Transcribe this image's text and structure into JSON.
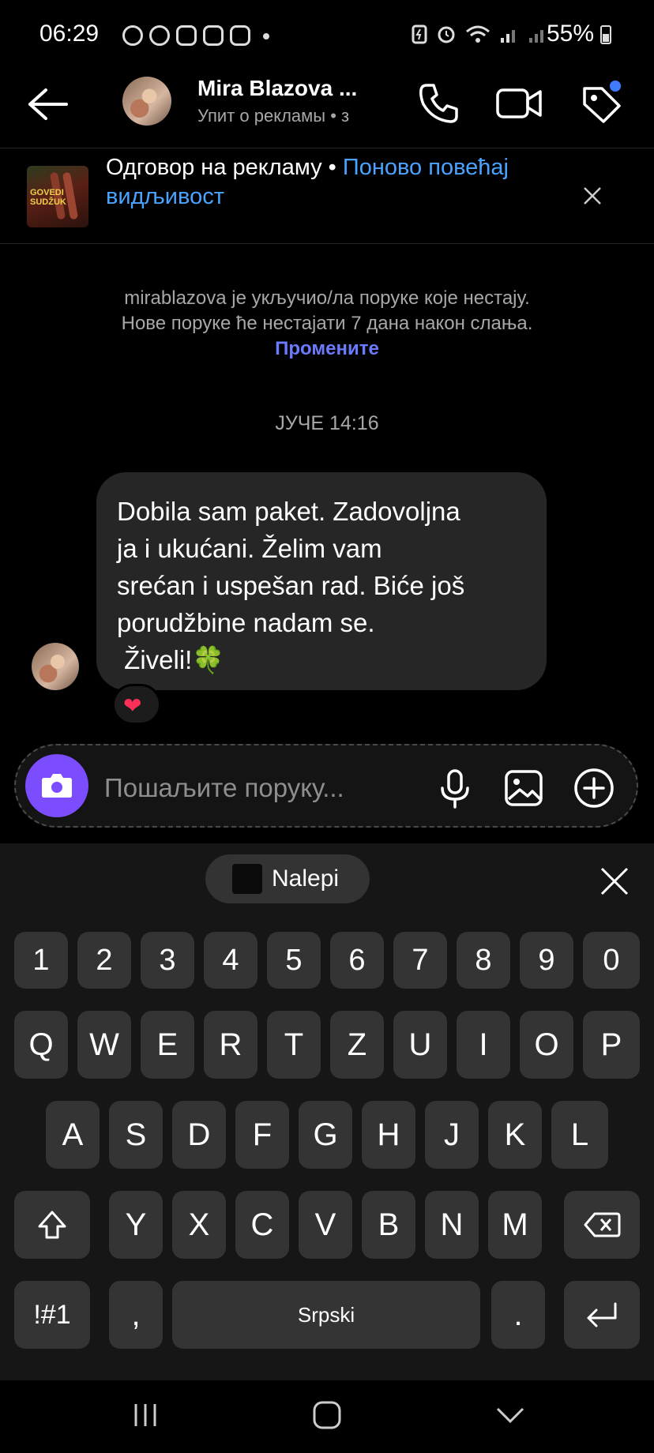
{
  "status_bar": {
    "time": "06:29",
    "battery": "55%"
  },
  "header": {
    "name": "Mira Blazova ...",
    "subtitle": "Упит о рекламы • з"
  },
  "ad_banner": {
    "prefix": "Одговор на рекламу • ",
    "link": "Поново повећај видљивост",
    "thumb_label": "GOVEDI SUDŽUK"
  },
  "system_notice": {
    "line1": "mirablazova је укључио/ла поруке које нестају.",
    "line2": "Нове поруке ће нестајати 7 дана након слања.",
    "link": "Промените"
  },
  "date_separator": "ЈУЧЕ 14:16",
  "message": {
    "text": "Dobila sam paket. Zadovoljna\nja i ukućani. Želim vam\nsrećan i uspešan rad. Biće još\nporudžbine nadam se.\n Živeli!🍀",
    "reaction": "❤"
  },
  "composer": {
    "placeholder": "Пошаљите поруку..."
  },
  "keyboard": {
    "paste_label": "Nalepi",
    "row_numbers": [
      "1",
      "2",
      "3",
      "4",
      "5",
      "6",
      "7",
      "8",
      "9",
      "0"
    ],
    "row1": [
      "Q",
      "W",
      "E",
      "R",
      "T",
      "Z",
      "U",
      "I",
      "O",
      "P"
    ],
    "row2": [
      "A",
      "S",
      "D",
      "F",
      "G",
      "H",
      "J",
      "K",
      "L"
    ],
    "row3": [
      "Y",
      "X",
      "C",
      "V",
      "B",
      "N",
      "M"
    ],
    "symbols_key": "!#1",
    "comma": ",",
    "space": "Srpski",
    "period": "."
  }
}
